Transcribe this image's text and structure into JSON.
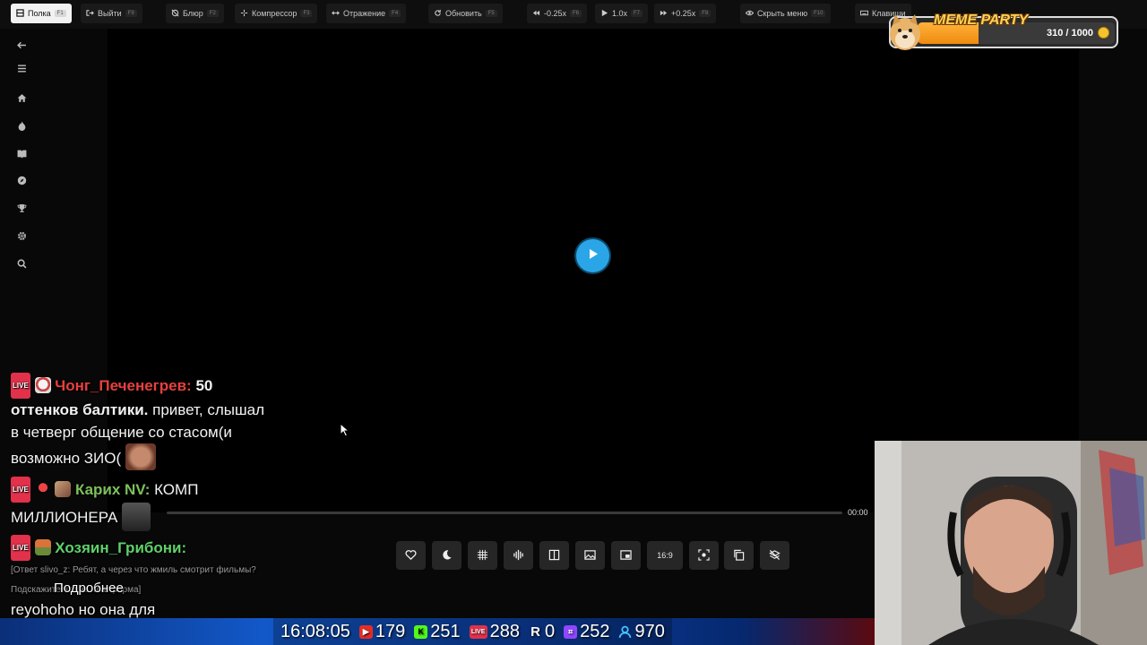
{
  "toolbar": {
    "items": [
      {
        "label": "Полка",
        "key": "F1",
        "icon": "shelf-icon"
      },
      {
        "label": "Выйти",
        "key": "F9",
        "icon": "exit-icon"
      },
      {
        "label": "Блюр",
        "key": "F2",
        "icon": "blur-icon"
      },
      {
        "label": "Компрессор",
        "key": "F3",
        "icon": "compressor-icon"
      },
      {
        "label": "Отражение",
        "key": "F4",
        "icon": "mirror-icon"
      },
      {
        "label": "Обновить",
        "key": "F5",
        "icon": "refresh-icon"
      },
      {
        "label": "-0.25x",
        "key": "F6",
        "icon": "rewind-icon"
      },
      {
        "label": "1.0x",
        "key": "F7",
        "icon": "play-icon"
      },
      {
        "label": "+0.25x",
        "key": "F8",
        "icon": "fast-forward-icon"
      },
      {
        "label": "Скрыть меню",
        "key": "F10",
        "icon": "eye-icon"
      },
      {
        "label": "Клавиши",
        "key": "",
        "icon": "keyboard-icon"
      }
    ]
  },
  "sidebar": {
    "items": [
      {
        "name": "back",
        "icon": "arrow-left-icon"
      },
      {
        "name": "menu",
        "icon": "hamburger-icon"
      },
      {
        "name": "home",
        "icon": "home-icon"
      },
      {
        "name": "popular",
        "icon": "fire-icon"
      },
      {
        "name": "library",
        "icon": "book-icon"
      },
      {
        "name": "explore",
        "icon": "compass-icon"
      },
      {
        "name": "trophy",
        "icon": "trophy-icon"
      },
      {
        "name": "settings",
        "icon": "gear-icon"
      },
      {
        "name": "search",
        "icon": "search-icon"
      }
    ]
  },
  "player": {
    "time": "00:00",
    "progress": 0,
    "controls": [
      {
        "name": "favorite",
        "icon": "heart-icon",
        "label": ""
      },
      {
        "name": "night-mode",
        "icon": "moon-icon",
        "label": ""
      },
      {
        "name": "grid",
        "icon": "grid-icon",
        "label": ""
      },
      {
        "name": "audio",
        "icon": "waveform-icon",
        "label": ""
      },
      {
        "name": "split",
        "icon": "split-icon",
        "label": ""
      },
      {
        "name": "picture",
        "icon": "picture-icon",
        "label": ""
      },
      {
        "name": "pip",
        "icon": "pip-icon",
        "label": ""
      },
      {
        "name": "aspect",
        "icon": "aspect-ratio-icon",
        "label": "16:9"
      },
      {
        "name": "screenshot",
        "icon": "screenshot-icon",
        "label": ""
      },
      {
        "name": "copy",
        "icon": "copy-icon",
        "label": ""
      },
      {
        "name": "layers-off",
        "icon": "layers-off-icon",
        "label": ""
      }
    ]
  },
  "chat": {
    "messages": [
      {
        "badge": "LIVE",
        "nick": "Чонг_Печенегрев:",
        "bold_text": "50 оттенков балтики.",
        "text": " привет, слышал в четверг общение со стасом(и возможно ЗИО("
      },
      {
        "badge": "LIVE",
        "nick": "Карих NV:",
        "text": " КОМП МИЛЛИОНЕРА"
      },
      {
        "badge": "LIVE",
        "nick": "Хозяин_Грибони:",
        "reply": "[Ответ slivo_z: Ребят, а через что жмиль смотрит фильмы? Подскажите что за платформа]",
        "overlay_text": "Подробнее",
        "text": "reyohoho но она для привилегированных"
      }
    ]
  },
  "stats": {
    "clock": "16:08:05",
    "youtube": "179",
    "kick": "251",
    "live": "288",
    "r": "0",
    "twitch": "252",
    "viewers": "970"
  },
  "meme_party": {
    "title": "MEME PARTY",
    "score": "310 / 1000",
    "progress": 0.31
  },
  "colors": {
    "accent": "#2aa6e8",
    "live_red": "#e2314b",
    "coin": "#f4c430"
  }
}
